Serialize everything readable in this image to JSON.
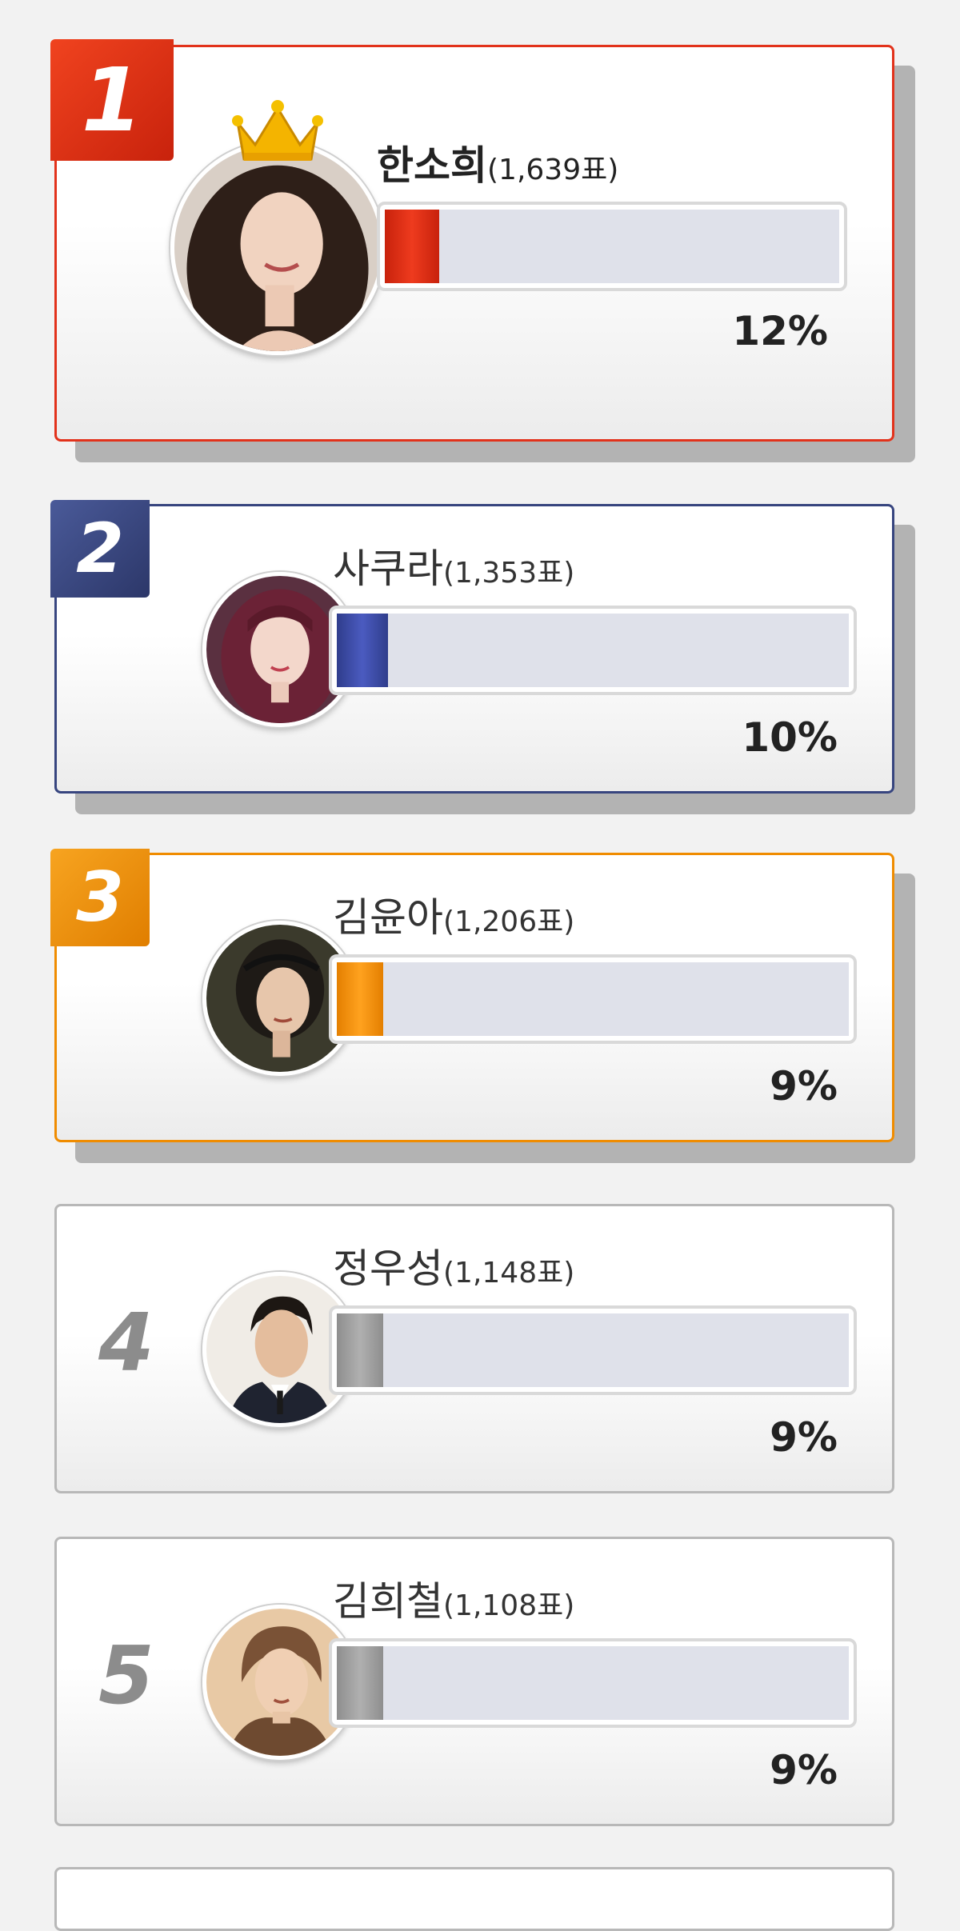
{
  "entries": [
    {
      "rank": "1",
      "name": "한소희",
      "votes": "(1,639표)",
      "percent": "12%",
      "share": 0.12,
      "color": "#e2321b",
      "avatar": "portrait-woman-long-hair"
    },
    {
      "rank": "2",
      "name": "사쿠라",
      "votes": "(1,353표)",
      "percent": "10%",
      "share": 0.1,
      "color": "#37457f",
      "avatar": "portrait-woman-bangs"
    },
    {
      "rank": "3",
      "name": "김윤아",
      "votes": "(1,206표)",
      "percent": "9%",
      "share": 0.09,
      "color": "#f08c00",
      "avatar": "portrait-woman-headband"
    },
    {
      "rank": "4",
      "name": "정우성",
      "votes": "(1,148표)",
      "percent": "9%",
      "share": 0.09,
      "color": "#9a9a9a",
      "avatar": "portrait-man-suit"
    },
    {
      "rank": "5",
      "name": "김희철",
      "votes": "(1,108표)",
      "percent": "9%",
      "share": 0.09,
      "color": "#9a9a9a",
      "avatar": "portrait-man-blond"
    }
  ],
  "icons": {
    "winner": "crown-icon"
  }
}
